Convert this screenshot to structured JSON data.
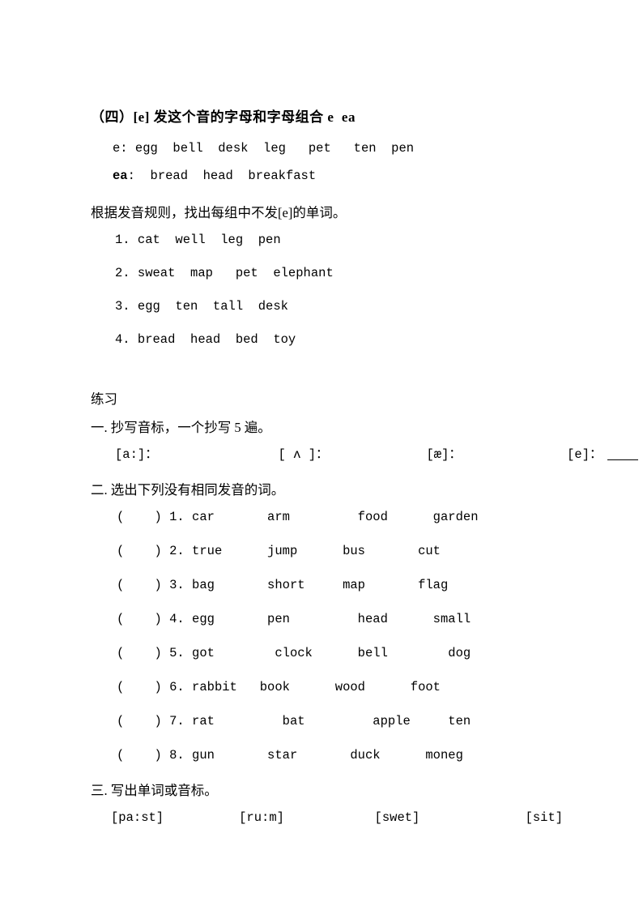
{
  "document": {
    "heading": "（四）[e] 发这个音的字母和字母组合 e  ea",
    "letter_groups": [
      {
        "label": "e:",
        "label_bold": false,
        "words": " egg  bell  desk  leg   pet   ten  pen"
      },
      {
        "label": "ea",
        "label_bold": true,
        "words": ":  bread  head  breakfast"
      }
    ],
    "instruction": "根据发音规则，找出每组中不发[e]的单词。",
    "word_groups": [
      "1. cat  well  leg  pen",
      "2. sweat  map   pet  elephant",
      "3. egg  ten  tall  desk",
      "4. bread  head  bed  toy"
    ],
    "exercises_title": "练习",
    "section_one": {
      "title": "一. 抄写音标，一个抄写 5 遍。",
      "symbols": [
        {
          "text": "[a:]：",
          "gap_after": 16
        },
        {
          "text": "[ ʌ ]：",
          "gap_after": 13
        },
        {
          "text": "[æ]：",
          "gap_after": 14
        },
        {
          "text": "[e]：",
          "gap_after": 0
        }
      ],
      "has_trailing_blank": true
    },
    "section_two": {
      "title": "二. 选出下列没有相同发音的词。",
      "items": [
        {
          "bracket": "(    )",
          "number": "1.",
          "words": " car       arm         food      garden"
        },
        {
          "bracket": "(    )",
          "number": "2.",
          "words": " true      jump      bus       cut"
        },
        {
          "bracket": "(    )",
          "number": "3.",
          "words": " bag       short     map       flag"
        },
        {
          "bracket": "(    )",
          "number": "4.",
          "words": " egg       pen         head      small"
        },
        {
          "bracket": "(    )",
          "number": "5.",
          "words": " got        clock      bell        dog"
        },
        {
          "bracket": "(    )",
          "number": "6.",
          "words": " rabbit   book      wood      foot"
        },
        {
          "bracket": "(    )",
          "number": "7.",
          "words": " rat         bat         apple     ten"
        },
        {
          "bracket": "(    )",
          "number": "8.",
          "words": " gun       star       duck      moneg"
        }
      ]
    },
    "section_three": {
      "title": "三. 写出单词或音标。",
      "phonetics": "[pa:st]          [ru:m]            [swet]              [sit]"
    }
  }
}
